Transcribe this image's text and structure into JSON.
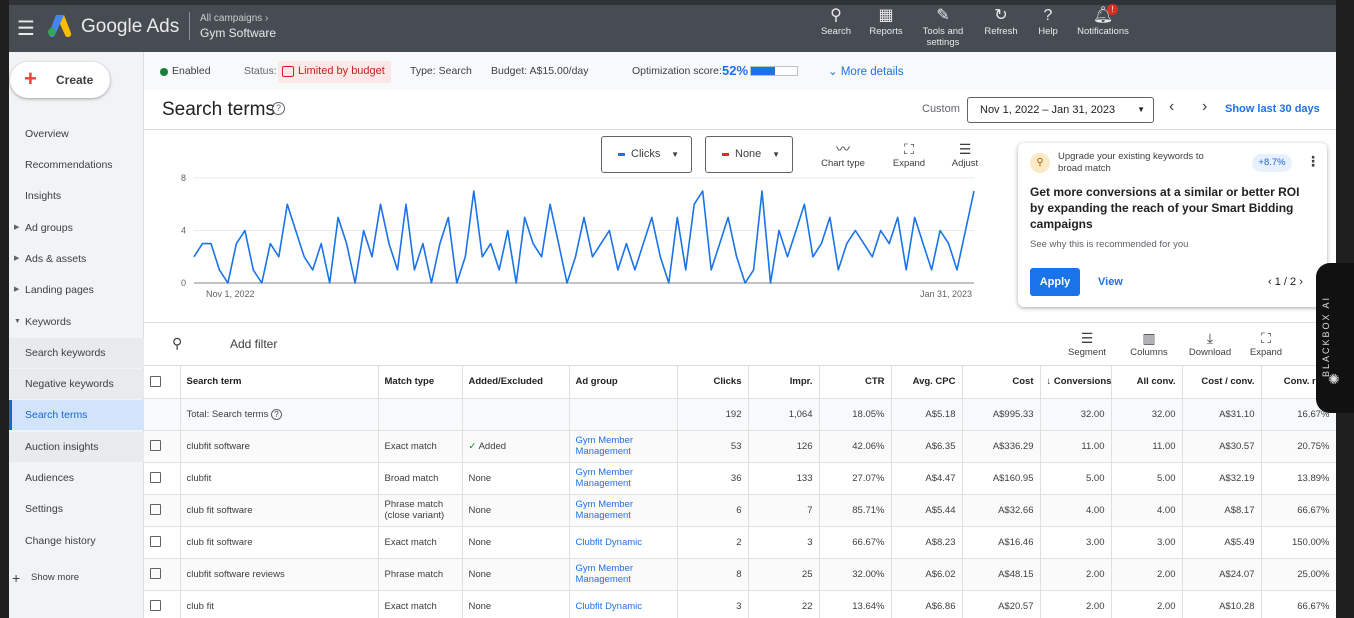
{
  "topbar": {
    "brand": "Google Ads",
    "crumb_small": "All campaigns",
    "crumb_big": "Gym Software",
    "buttons": [
      {
        "label": "Search",
        "icon": "search-icon"
      },
      {
        "label": "Reports",
        "icon": "reports-icon"
      },
      {
        "label": "Tools and settings",
        "icon": "wrench-icon"
      },
      {
        "label": "Refresh",
        "icon": "refresh-icon"
      },
      {
        "label": "Help",
        "icon": "help-icon"
      },
      {
        "label": "Notifications",
        "icon": "bell-icon"
      }
    ],
    "notif_badge": "!"
  },
  "sidebar": {
    "create": "Create",
    "items": [
      "Overview",
      "Recommendations",
      "Insights",
      "Ad groups",
      "Ads & assets",
      "Landing pages",
      "Keywords",
      "Search keywords",
      "Negative keywords",
      "Search terms",
      "Auction insights",
      "Audiences",
      "Settings",
      "Change history"
    ],
    "show_more": "Show more"
  },
  "status": {
    "enabled": "Enabled",
    "status_label": "Status:",
    "status_value": "Limited by budget",
    "type": "Type: Search",
    "budget": "Budget: A$15.00/day",
    "opt_label": "Optimization score:",
    "opt_value": "52%",
    "opt_fill": 0.52,
    "more": "More details"
  },
  "header": {
    "title": "Search terms",
    "custom": "Custom",
    "daterange": "Nov 1, 2022 – Jan 31, 2023",
    "show_last": "Show last 30 days"
  },
  "chart_controls": {
    "metric1": "Clicks",
    "metric2": "None",
    "tools": [
      "Chart type",
      "Expand",
      "Adjust"
    ]
  },
  "chart_data": {
    "type": "line",
    "title": "",
    "xlabel": "",
    "ylabel": "",
    "ylim": [
      0,
      8
    ],
    "yticks": [
      "0",
      "4",
      "8"
    ],
    "x_start": "Nov 1, 2022",
    "x_end": "Jan 31, 2023",
    "series": [
      {
        "name": "Clicks",
        "color": "#1a73e8",
        "values": [
          2,
          3,
          3,
          1,
          0,
          3,
          4,
          1,
          0,
          3,
          2,
          6,
          4,
          2,
          1,
          3,
          0,
          5,
          3,
          0,
          4,
          2,
          6,
          3,
          1,
          6,
          1,
          3,
          0,
          3,
          5,
          0,
          2,
          7,
          2,
          3,
          1,
          4,
          0,
          5,
          3,
          2,
          6,
          3,
          0,
          2,
          5,
          2,
          3,
          4,
          1,
          3,
          1,
          3,
          5,
          2,
          0,
          5,
          1,
          6,
          7,
          1,
          3,
          5,
          2,
          0,
          1,
          7,
          0,
          4,
          2,
          4,
          6,
          2,
          3,
          5,
          1,
          3,
          4,
          3,
          2,
          4,
          3,
          5,
          1,
          5,
          3,
          1,
          4,
          3,
          1,
          4,
          7
        ]
      }
    ]
  },
  "rec": {
    "head": "Upgrade your existing keywords to broad match",
    "pct": "+8.7%",
    "body": "Get more conversions at a similar or better ROI by expanding the reach of your Smart Bidding campaigns",
    "why": "See why this is recommended for you",
    "apply": "Apply",
    "view": "View",
    "pager": "1 / 2"
  },
  "blackbox": "BLACKBOX AI",
  "filterbar": {
    "add_filter": "Add filter",
    "tools": [
      "Segment",
      "Columns",
      "Download",
      "Expand"
    ]
  },
  "table": {
    "headers": [
      "Search term",
      "Match type",
      "Added/Excluded",
      "Ad group",
      "Clicks",
      "Impr.",
      "CTR",
      "Avg. CPC",
      "Cost",
      "Conversions",
      "All conv.",
      "Cost / conv.",
      "Conv. rate"
    ],
    "total": [
      "Total: Search terms",
      "",
      "",
      "",
      "192",
      "1,064",
      "18.05%",
      "A$5.18",
      "A$995.33",
      "32.00",
      "32.00",
      "A$31.10",
      "16.67%"
    ],
    "rows": [
      [
        "clubfit software",
        "Exact match",
        "Added",
        "Gym Member Management",
        "53",
        "126",
        "42.06%",
        "A$6.35",
        "A$336.29",
        "11.00",
        "11.00",
        "A$30.57",
        "20.75%"
      ],
      [
        "clubfit",
        "Broad match",
        "None",
        "Gym Member Management",
        "36",
        "133",
        "27.07%",
        "A$4.47",
        "A$160.95",
        "5.00",
        "5.00",
        "A$32.19",
        "13.89%"
      ],
      [
        "club fit software",
        "Phrase match (close variant)",
        "None",
        "Gym Member Management",
        "6",
        "7",
        "85.71%",
        "A$5.44",
        "A$32.66",
        "4.00",
        "4.00",
        "A$8.17",
        "66.67%"
      ],
      [
        "club fit software",
        "Exact match",
        "None",
        "Clubfit Dynamic",
        "2",
        "3",
        "66.67%",
        "A$8.23",
        "A$16.46",
        "3.00",
        "3.00",
        "A$5.49",
        "150.00%"
      ],
      [
        "clubfit software reviews",
        "Phrase match",
        "None",
        "Gym Member Management",
        "8",
        "25",
        "32.00%",
        "A$6.02",
        "A$48.15",
        "2.00",
        "2.00",
        "A$24.07",
        "25.00%"
      ],
      [
        "club fit",
        "Exact match",
        "None",
        "Clubfit Dynamic",
        "3",
        "22",
        "13.64%",
        "A$6.86",
        "A$20.57",
        "2.00",
        "2.00",
        "A$10.28",
        "66.67%"
      ]
    ]
  }
}
